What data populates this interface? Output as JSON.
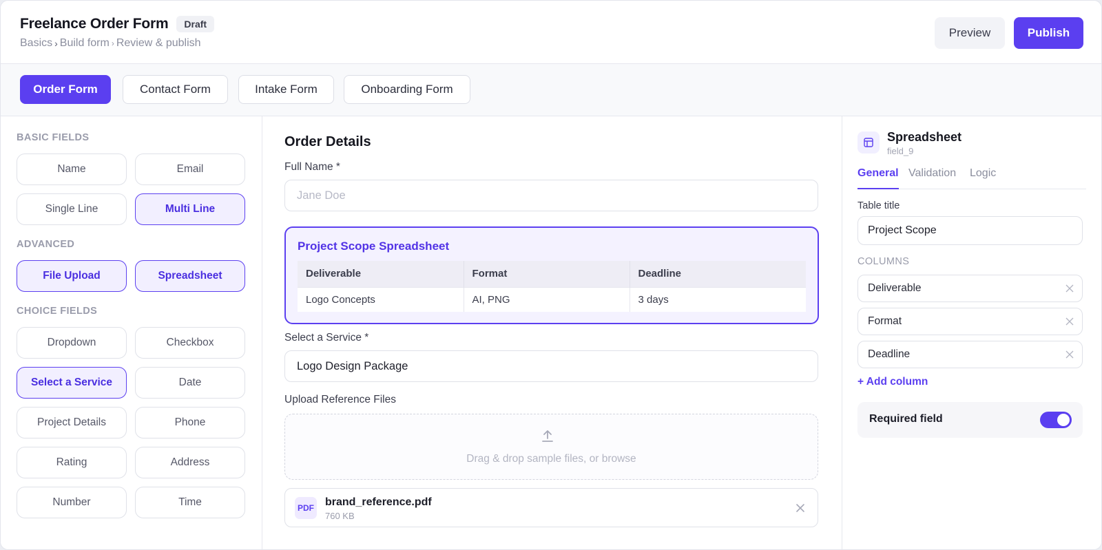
{
  "header": {
    "title": "Freelance Order Form",
    "badge": "Draft",
    "breadcrumb": [
      "Basics",
      "Build form",
      "Review & publish"
    ],
    "preview_label": "Preview",
    "publish_label": "Publish"
  },
  "form_tabs": [
    {
      "label": "Order Form",
      "active": true
    },
    {
      "label": "Contact Form",
      "active": false
    },
    {
      "label": "Intake Form",
      "active": false
    },
    {
      "label": "Onboarding Form",
      "active": false
    }
  ],
  "palette": {
    "basic_label": "BASIC FIELDS",
    "basic": [
      "Name",
      "Email",
      "Single Line",
      "Multi Line"
    ],
    "advanced_label": "ADVANCED",
    "advanced": [
      "File Upload",
      "Spreadsheet"
    ],
    "choice_label": "CHOICE FIELDS",
    "choice": [
      "Dropdown",
      "Checkbox",
      "Select a Service",
      "Date",
      "Project Details",
      "Phone",
      "Rating",
      "Address",
      "Number",
      "Time"
    ]
  },
  "canvas": {
    "title": "Order Details",
    "full_name_label": "Full Name *",
    "full_name_placeholder": "Jane Doe",
    "spreadsheet": {
      "title": "Project Scope Spreadsheet",
      "headers": [
        "Deliverable",
        "Format",
        "Deadline"
      ],
      "rows": [
        [
          "Logo Concepts",
          "AI, PNG",
          "3 days"
        ]
      ]
    },
    "service_label": "Select a Service *",
    "service_value": "Logo Design Package",
    "upload_label": "Upload Reference Files",
    "upload_hint": "Drag & drop sample files, or browse",
    "file": {
      "badge": "PDF",
      "name": "brand_reference.pdf",
      "size": "760 KB"
    }
  },
  "inspector": {
    "title": "Spreadsheet",
    "field_id": "field_9",
    "tabs": [
      "General",
      "Validation",
      "Logic"
    ],
    "table_title_label": "Table title",
    "table_title_value": "Project Scope",
    "columns_label": "COLUMNS",
    "columns": [
      "Deliverable",
      "Format",
      "Deadline"
    ],
    "add_column": "+ Add column",
    "required_label": "Required field",
    "required_on": true
  },
  "colors": {
    "accent": "#5b3ff0",
    "accent_light": "#f2efff",
    "muted": "#9a9cab"
  }
}
